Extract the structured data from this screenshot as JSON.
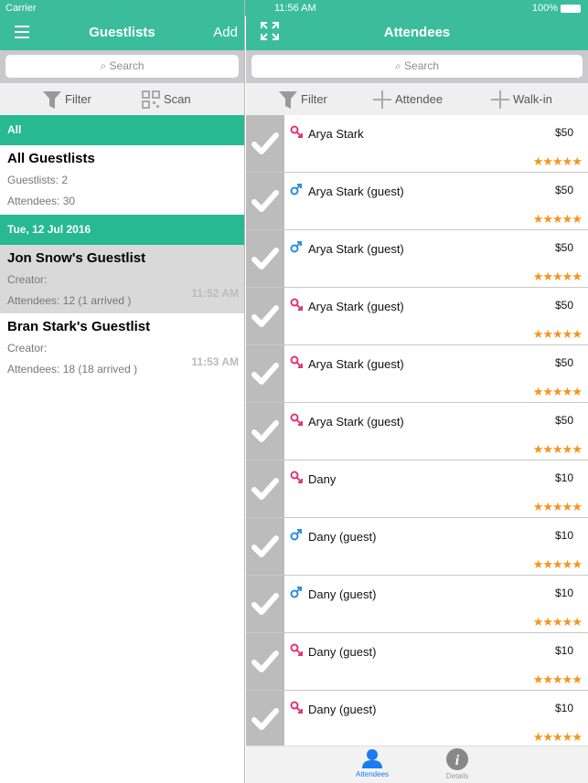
{
  "status": {
    "carrier": "Carrier",
    "time": "11:56 AM",
    "battery": "100%"
  },
  "left": {
    "title": "Guestlists",
    "add_label": "Add",
    "search_placeholder": "Search",
    "filter_label": "Filter",
    "scan_label": "Scan",
    "sections": [
      {
        "header": "All",
        "items": [
          {
            "title": "All Guestlists",
            "line1": "Guestlists: 2",
            "line2": "Attendees: 30",
            "time": ""
          }
        ]
      },
      {
        "header": "Tue, 12 Jul 2016",
        "items": [
          {
            "title": "Jon Snow's Guestlist",
            "line1": "Creator:",
            "line2": "Attendees: 12 (1 arrived )",
            "time": "11:52 AM",
            "selected": true
          },
          {
            "title": "Bran Stark's Guestlist",
            "line1": "Creator:",
            "line2": "Attendees: 18 (18 arrived )",
            "time": "11:53 AM"
          }
        ]
      }
    ]
  },
  "right": {
    "title": "Attendees",
    "search_placeholder": "Search",
    "filter_label": "Filter",
    "attendee_label": "Attendee",
    "walkin_label": "Walk-in",
    "attendees": [
      {
        "name": "Arya Stark",
        "price": "$50",
        "gender": "female",
        "rating": 5
      },
      {
        "name": "Arya Stark (guest)",
        "price": "$50",
        "gender": "male",
        "rating": 5
      },
      {
        "name": "Arya Stark (guest)",
        "price": "$50",
        "gender": "male",
        "rating": 5
      },
      {
        "name": "Arya Stark (guest)",
        "price": "$50",
        "gender": "female",
        "rating": 5
      },
      {
        "name": "Arya Stark (guest)",
        "price": "$50",
        "gender": "female",
        "rating": 5
      },
      {
        "name": "Arya Stark (guest)",
        "price": "$50",
        "gender": "female",
        "rating": 5
      },
      {
        "name": "Dany",
        "price": "$10",
        "gender": "female",
        "rating": 5
      },
      {
        "name": "Dany (guest)",
        "price": "$10",
        "gender": "male",
        "rating": 5
      },
      {
        "name": "Dany (guest)",
        "price": "$10",
        "gender": "male",
        "rating": 5
      },
      {
        "name": "Dany (guest)",
        "price": "$10",
        "gender": "female",
        "rating": 5
      },
      {
        "name": "Dany (guest)",
        "price": "$10",
        "gender": "female",
        "rating": 5
      }
    ],
    "tabs": [
      {
        "label": "Attendees",
        "active": true
      },
      {
        "label": "Details",
        "active": false
      }
    ]
  },
  "colors": {
    "accent": "#3bbd9c",
    "section": "#26b992",
    "female": "#e0357a",
    "male": "#2a8ee0",
    "star": "#f7941d",
    "tab_active": "#1a7cf0"
  }
}
